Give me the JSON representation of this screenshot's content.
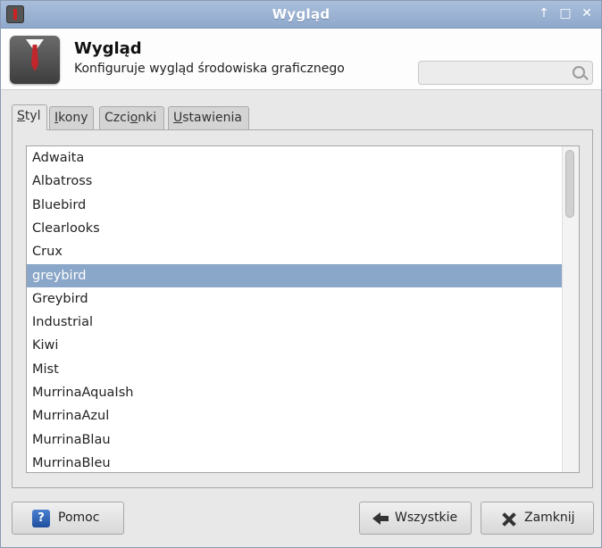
{
  "window": {
    "title": "Wygląd",
    "controls": [
      "↑",
      "□",
      "✕"
    ]
  },
  "header": {
    "title": "Wygląd",
    "subtitle": "Konfiguruje wygląd środowiska graficznego"
  },
  "search": {
    "value": "",
    "placeholder": ""
  },
  "tabs": [
    {
      "label_pre": "",
      "mnemonic": "S",
      "label_post": "tyl",
      "active": true
    },
    {
      "label_pre": "",
      "mnemonic": "I",
      "label_post": "kony",
      "active": false
    },
    {
      "label_pre": "Czci",
      "mnemonic": "o",
      "label_post": "nki",
      "active": false
    },
    {
      "label_pre": "",
      "mnemonic": "U",
      "label_post": "stawienia",
      "active": false
    }
  ],
  "themes": {
    "selected_index": 5,
    "items": [
      "Adwaita",
      "Albatross",
      "Bluebird",
      "Clearlooks",
      "Crux",
      "greybird",
      "Greybird",
      "Industrial",
      "Kiwi",
      "Mist",
      "MurrinaAquaIsh",
      "MurrinaAzul",
      "MurrinaBlau",
      "MurrinaBleu"
    ]
  },
  "buttons": {
    "help": "Pomoc",
    "all": "Wszystkie",
    "close": "Zamknij"
  },
  "colors": {
    "titlebar": "#98b0d1",
    "selection": "#8aa6c8"
  }
}
